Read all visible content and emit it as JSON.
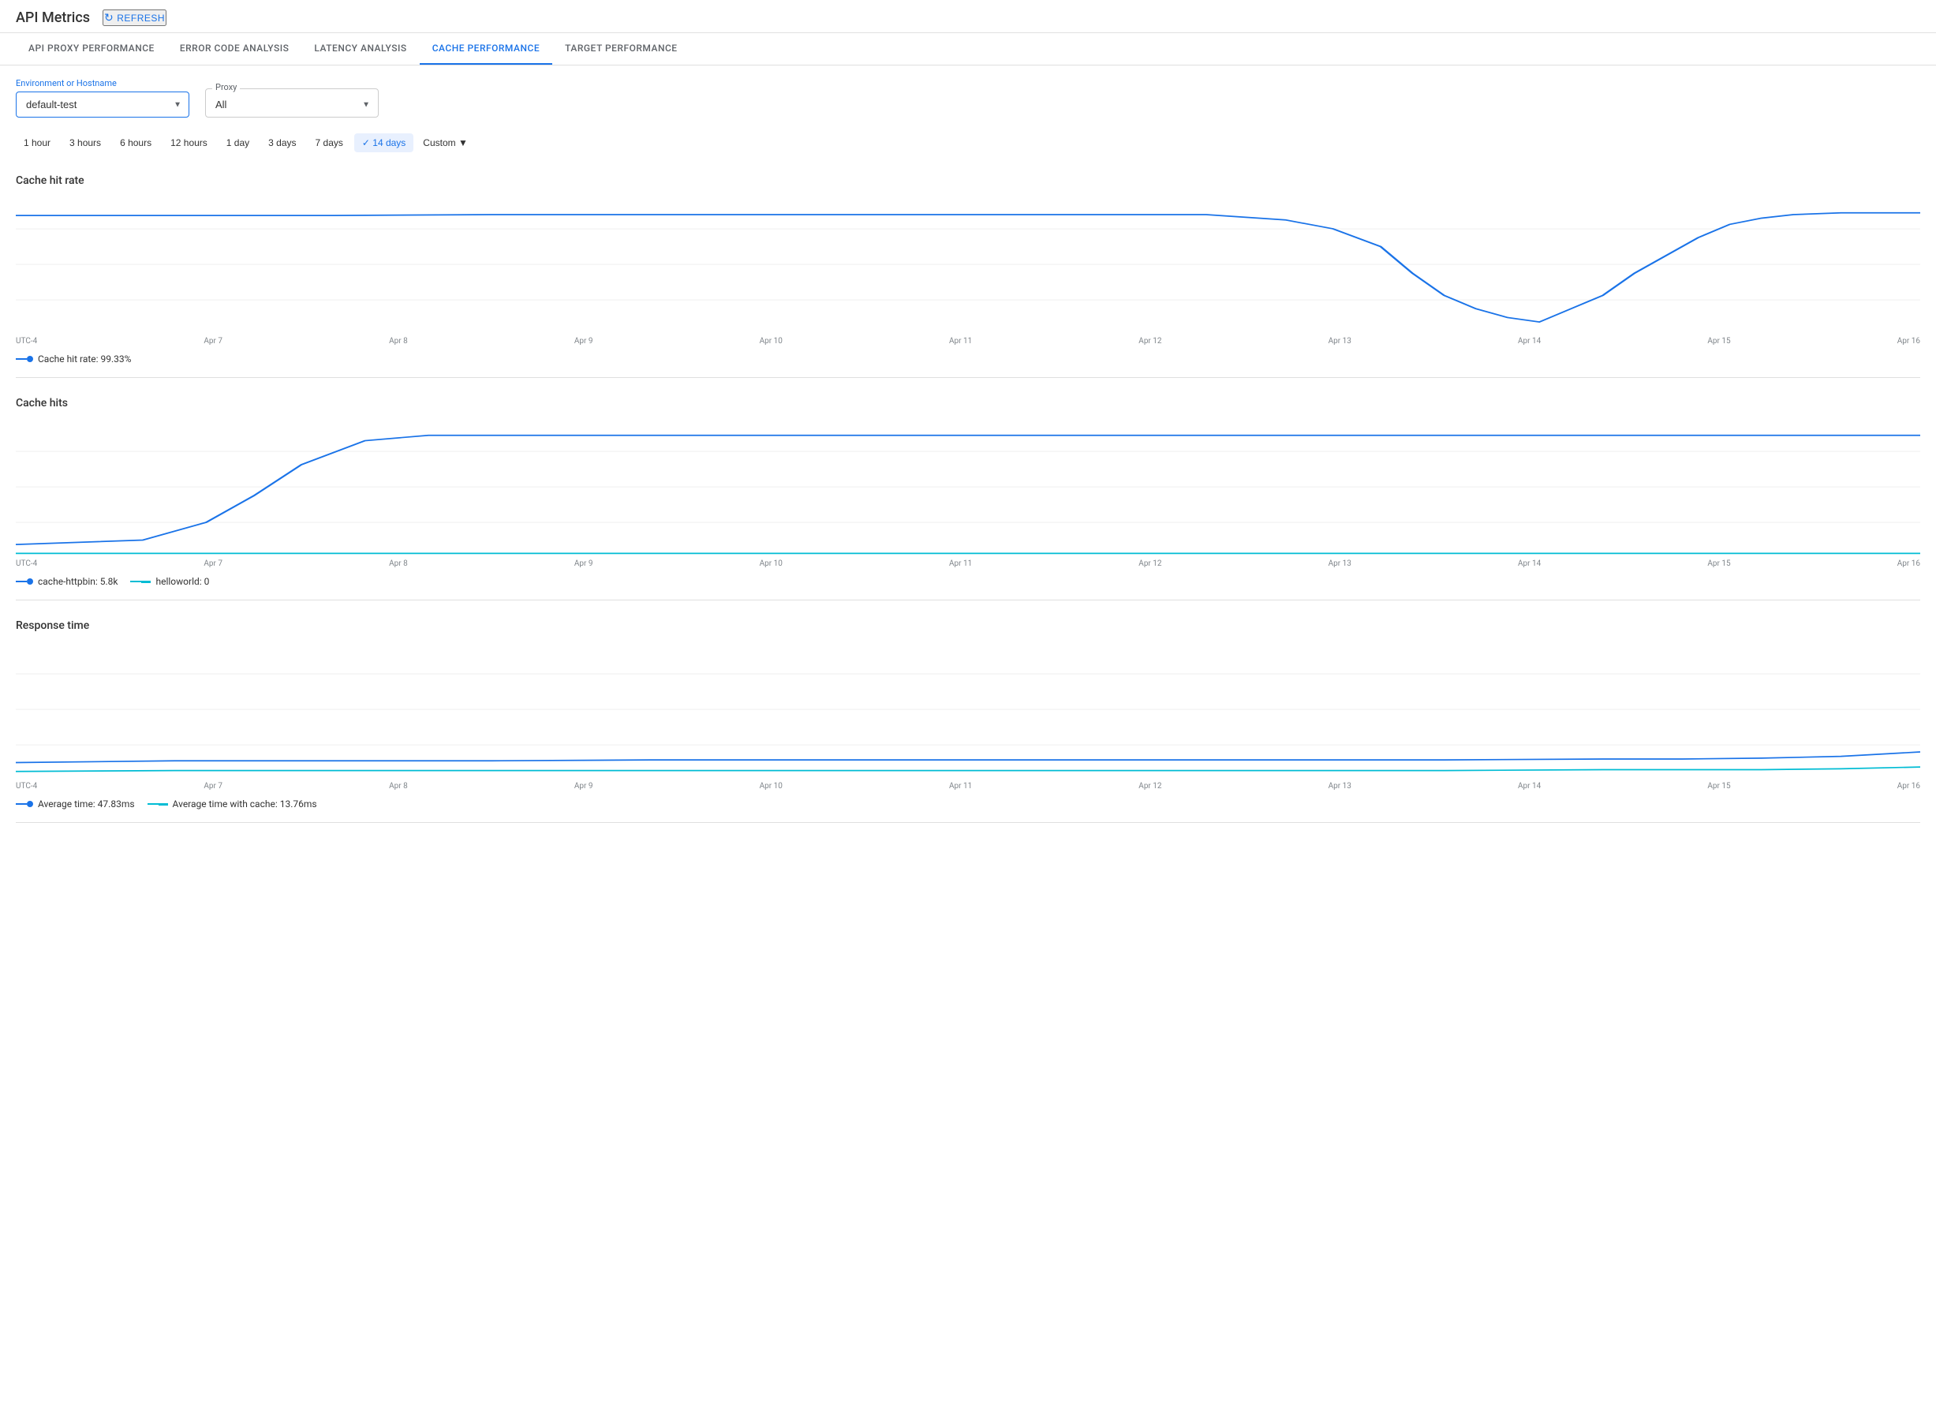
{
  "header": {
    "title": "API Metrics",
    "refresh_label": "REFRESH"
  },
  "tabs": [
    {
      "id": "api-proxy",
      "label": "API PROXY PERFORMANCE",
      "active": false
    },
    {
      "id": "error-code",
      "label": "ERROR CODE ANALYSIS",
      "active": false
    },
    {
      "id": "latency",
      "label": "LATENCY ANALYSIS",
      "active": false
    },
    {
      "id": "cache",
      "label": "CACHE PERFORMANCE",
      "active": true
    },
    {
      "id": "target",
      "label": "TARGET PERFORMANCE",
      "active": false
    }
  ],
  "filters": {
    "environment_label": "Environment or Hostname",
    "environment_value": "default-test",
    "proxy_label": "Proxy",
    "proxy_value": "All"
  },
  "time_filters": {
    "options": [
      "1 hour",
      "3 hours",
      "6 hours",
      "12 hours",
      "1 day",
      "3 days",
      "7 days",
      "14 days",
      "Custom"
    ],
    "active": "14 days"
  },
  "charts": {
    "cache_hit_rate": {
      "title": "Cache hit rate",
      "legend": [
        {
          "label": "Cache hit rate: 99.33%",
          "color": "#1a73e8",
          "type": "line-dot"
        }
      ],
      "x_labels": [
        "UTC-4",
        "Apr 7",
        "Apr 8",
        "Apr 9",
        "Apr 10",
        "Apr 11",
        "Apr 12",
        "Apr 13",
        "Apr 14",
        "Apr 15",
        "Apr 16"
      ]
    },
    "cache_hits": {
      "title": "Cache hits",
      "legend": [
        {
          "label": "cache-httpbin: 5.8k",
          "color": "#1a73e8",
          "type": "line-dot"
        },
        {
          "label": "helloworld: 0",
          "color": "#00bcd4",
          "type": "line-square"
        }
      ],
      "x_labels": [
        "UTC-4",
        "Apr 7",
        "Apr 8",
        "Apr 9",
        "Apr 10",
        "Apr 11",
        "Apr 12",
        "Apr 13",
        "Apr 14",
        "Apr 15",
        "Apr 16"
      ]
    },
    "response_time": {
      "title": "Response time",
      "legend": [
        {
          "label": "Average time: 47.83ms",
          "color": "#1a73e8",
          "type": "line-dot"
        },
        {
          "label": "Average time with cache: 13.76ms",
          "color": "#00bcd4",
          "type": "line-square"
        }
      ],
      "x_labels": [
        "UTC-4",
        "Apr 7",
        "Apr 8",
        "Apr 9",
        "Apr 10",
        "Apr 11",
        "Apr 12",
        "Apr 13",
        "Apr 14",
        "Apr 15",
        "Apr 16"
      ]
    }
  }
}
